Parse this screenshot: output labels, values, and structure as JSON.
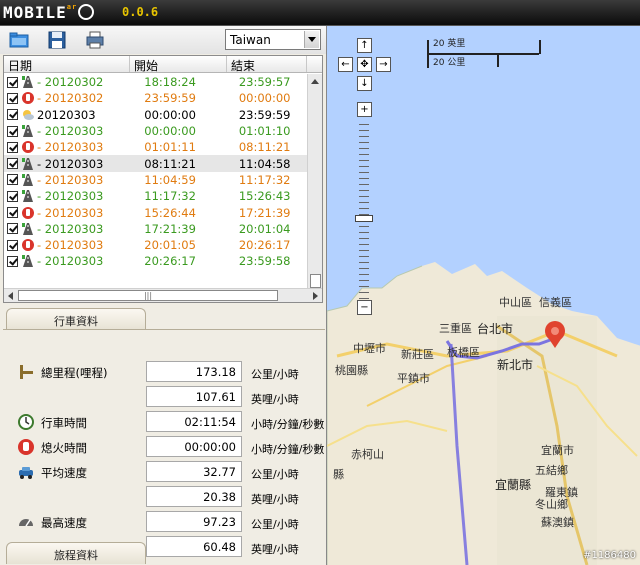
{
  "app": {
    "logo_text": "MOBILE",
    "logo_sup": "ar",
    "version": "0.0.6"
  },
  "toolbar": {
    "country": "Taiwan"
  },
  "table": {
    "headers": {
      "date": "日期",
      "start": "開始",
      "end": "結束"
    },
    "rows": [
      {
        "date": "- 20120302",
        "start": "18:18:24",
        "end": "23:59:57",
        "color": "green",
        "icon": "drive-icon"
      },
      {
        "date": "- 20120302",
        "start": "23:59:59",
        "end": "00:00:00",
        "color": "orange",
        "icon": "stop-icon"
      },
      {
        "date": "20120303",
        "start": "00:00:00",
        "end": "23:59:59",
        "color": "black",
        "icon": "weather-icon"
      },
      {
        "date": "- 20120303",
        "start": "00:00:00",
        "end": "01:01:10",
        "color": "green",
        "icon": "drive-icon"
      },
      {
        "date": "- 20120303",
        "start": "01:01:11",
        "end": "08:11:21",
        "color": "orange",
        "icon": "stop-icon"
      },
      {
        "date": "- 20120303",
        "start": "08:11:21",
        "end": "11:04:58",
        "color": "black",
        "icon": "drive-icon"
      },
      {
        "date": "- 20120303",
        "start": "11:04:59",
        "end": "11:17:32",
        "color": "orange",
        "icon": "drive-icon"
      },
      {
        "date": "- 20120303",
        "start": "11:17:32",
        "end": "15:26:43",
        "color": "green",
        "icon": "drive-icon"
      },
      {
        "date": "- 20120303",
        "start": "15:26:44",
        "end": "17:21:39",
        "color": "orange",
        "icon": "stop-icon"
      },
      {
        "date": "- 20120303",
        "start": "17:21:39",
        "end": "20:01:04",
        "color": "green",
        "icon": "drive-icon"
      },
      {
        "date": "- 20120303",
        "start": "20:01:05",
        "end": "20:26:17",
        "color": "orange",
        "icon": "stop-icon"
      },
      {
        "date": "- 20120303",
        "start": "20:26:17",
        "end": "23:59:58",
        "color": "green",
        "icon": "drive-icon"
      }
    ]
  },
  "tabs": {
    "drive_info": "行車資料",
    "travel_info": "旅程資料"
  },
  "metrics": [
    {
      "label": "總里程(哩程)",
      "value": "173.18",
      "unit": "公里/小時",
      "icon": "odometer-icon"
    },
    {
      "label": "",
      "value": "107.61",
      "unit": "英哩/小時",
      "icon": ""
    },
    {
      "label": "行車時間",
      "value": "02:11:54",
      "unit": "小時/分鐘/秒數",
      "icon": "clock-icon"
    },
    {
      "label": "熄火時間",
      "value": "00:00:00",
      "unit": "小時/分鐘/秒數",
      "icon": "stop-hand-icon"
    },
    {
      "label": "平均速度",
      "value": "32.77",
      "unit": "公里/小時",
      "icon": "car-icon"
    },
    {
      "label": "",
      "value": "20.38",
      "unit": "英哩/小時",
      "icon": ""
    },
    {
      "label": "最高速度",
      "value": "97.23",
      "unit": "公里/小時",
      "icon": "speedometer-icon"
    },
    {
      "label": "",
      "value": "60.48",
      "unit": "英哩/小時",
      "icon": ""
    }
  ],
  "map": {
    "scale_top": "20 英里",
    "scale_bottom": "20 公里",
    "places": [
      "中山區",
      "信義區",
      "台北市",
      "三重區",
      "新莊區",
      "板橋區",
      "桃園縣",
      "中壢市",
      "新北市",
      "平鎮市",
      "赤柯山",
      "宜蘭市",
      "五結鄉",
      "宜蘭縣",
      "羅東鎮",
      "冬山鄉",
      "蘇澳鎮",
      "縣"
    ],
    "watermark": "#1186480"
  }
}
